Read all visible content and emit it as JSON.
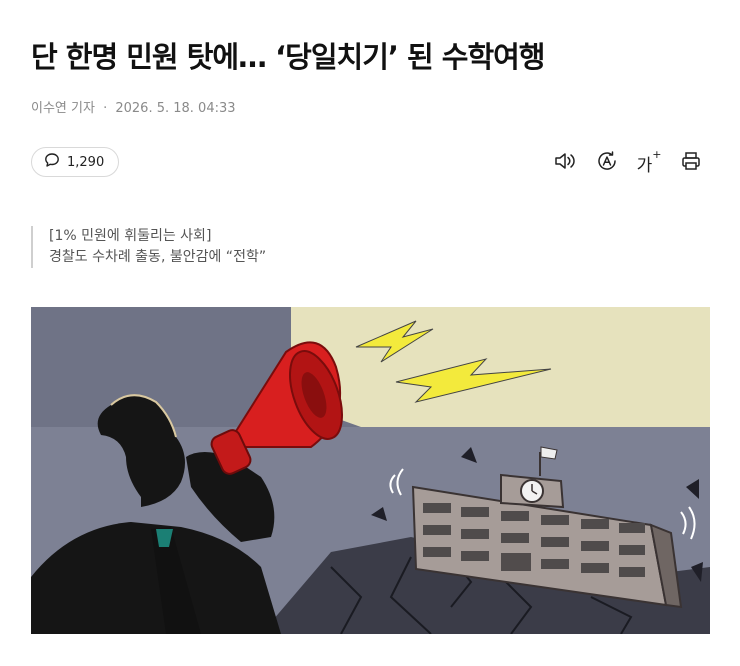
{
  "article": {
    "headline": "단 한명 민원 탓에… ‘당일치기’ 된 수학여행",
    "reporter": "이수연 기자",
    "separator": "·",
    "date": "2026. 5. 18. 04:33"
  },
  "toolbar": {
    "comment_count": "1,290",
    "icons": [
      "comment-icon",
      "speaker-icon",
      "translate-icon",
      "font-size-icon",
      "print-icon"
    ],
    "font_size_label": "가"
  },
  "summary": {
    "line1": "[1% 민원에 휘둘리는 사회]",
    "line2": "경찰도 수차례 출동, 불안감에 “전학”"
  },
  "illustration": {
    "colors": {
      "sky": "#7d8194",
      "spotlight": "#e6e2bd",
      "megaphone": "#d81f1f",
      "lightning": "#f3ea3c",
      "school": "#a69c98",
      "ground": "#3b3c48"
    }
  }
}
